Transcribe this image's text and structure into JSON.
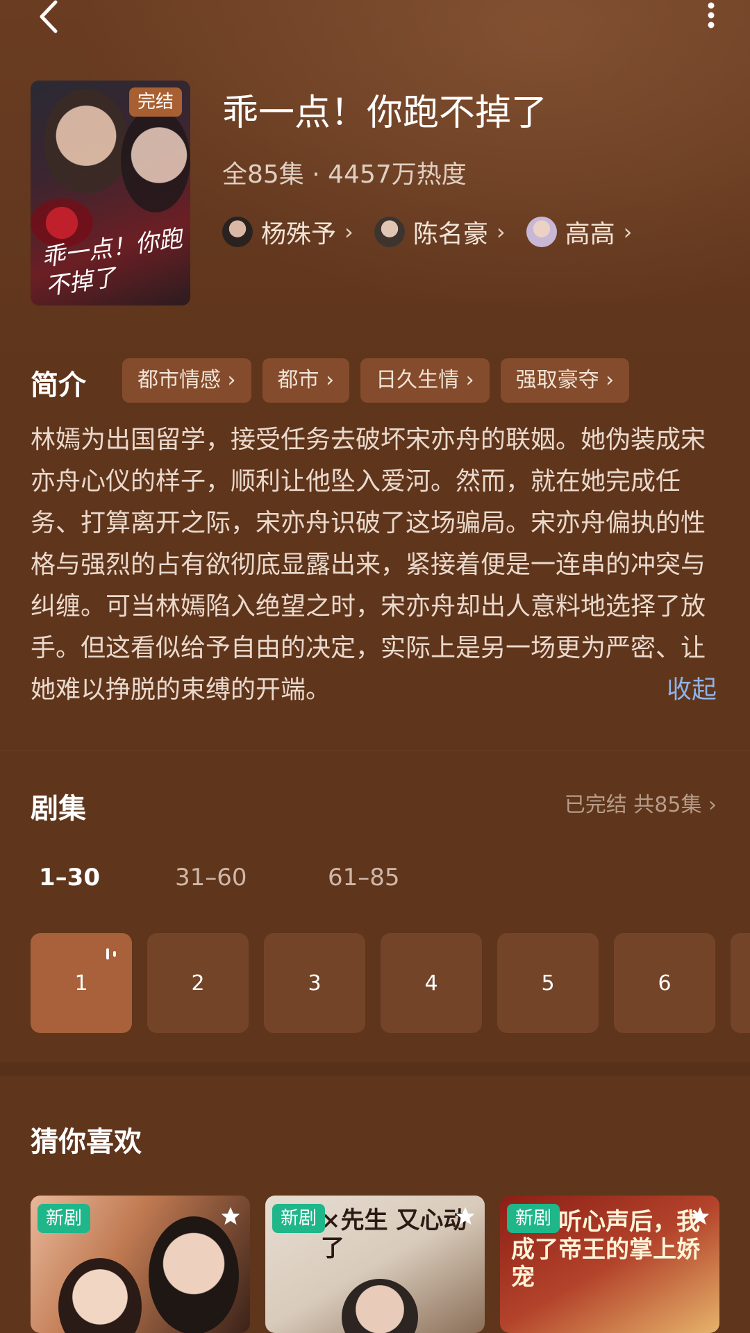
{
  "header": {
    "back_icon": "chevron-left-icon",
    "more_icon": "vertical-dots-icon"
  },
  "drama": {
    "title": "乖一点！你跑不掉了",
    "meta": "全85集 · 4457万热度",
    "status_badge": "完结",
    "poster_title": "乖一点！你跑不掉了",
    "cast": [
      {
        "name": "杨殊予"
      },
      {
        "name": "陈名豪"
      },
      {
        "name": "高高"
      }
    ]
  },
  "intro": {
    "label": "简介",
    "tags": [
      "都市情感",
      "都市",
      "日久生情",
      "强取豪夺"
    ],
    "text": "林嫣为出国留学，接受任务去破坏宋亦舟的联姻。她伪装成宋亦舟心仪的样子，顺利让他坠入爱河。然而，就在她完成任务、打算离开之际，宋亦舟识破了这场骗局。宋亦舟偏执的性格与强烈的占有欲彻底显露出来，紧接着便是一连串的冲突与纠缠。可当林嫣陷入绝望之时，宋亦舟却出人意料地选择了放手。但这看似给予自由的决定，实际上是另一场更为严密、让她难以挣脱的束缚的开端。",
    "collapse_label": "收起"
  },
  "episodes": {
    "label": "剧集",
    "status": "已完结 共85集",
    "ranges": [
      "1–30",
      "31–60",
      "61–85"
    ],
    "active_range": 0,
    "items": [
      "1",
      "2",
      "3",
      "4",
      "5",
      "6"
    ],
    "playing": "1"
  },
  "recommend": {
    "label": "猜你喜欢",
    "items": [
      {
        "badge": "新剧",
        "title": ""
      },
      {
        "badge": "新剧",
        "title": "×先生 又心动了"
      },
      {
        "badge": "新剧",
        "title": "被偷听心声后，我成了帝王的掌上娇宠"
      }
    ]
  },
  "colors": {
    "background": "#5f351c",
    "tag": "#844c2c",
    "active_episode": "#a8613a",
    "link": "#8fb3e8",
    "new_badge": "#1fb68a"
  }
}
